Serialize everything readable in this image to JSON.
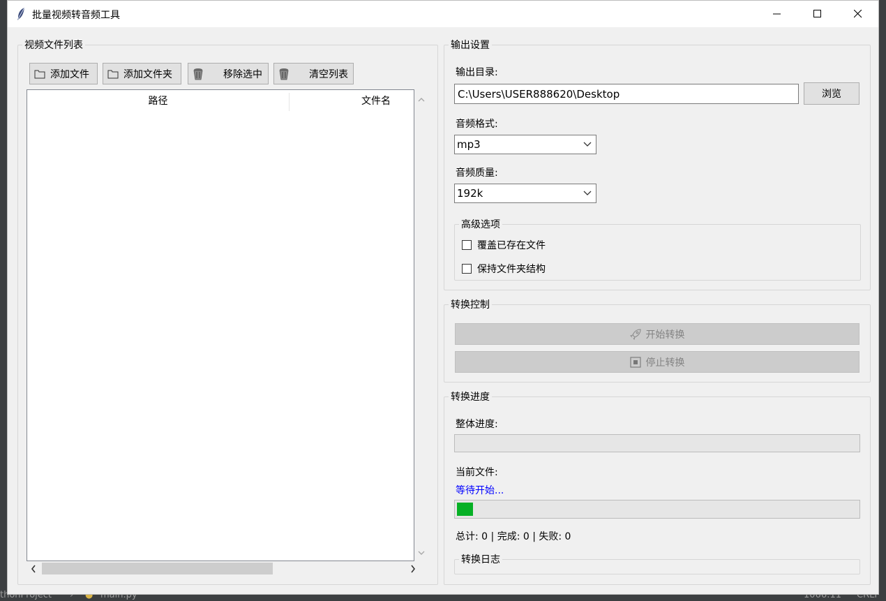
{
  "window": {
    "title": "批量视频转音频工具"
  },
  "file_list": {
    "title": "视频文件列表",
    "buttons": {
      "add_file": "添加文件",
      "add_folder": "添加文件夹",
      "remove_selected": "移除选中",
      "clear_list": "清空列表"
    },
    "columns": [
      "路径",
      "文件名"
    ],
    "rows": []
  },
  "output": {
    "title": "输出设置",
    "dir_label": "输出目录:",
    "dir_value": "C:\\Users\\USER888620\\Desktop",
    "browse": "浏览",
    "format_label": "音频格式:",
    "format_value": "mp3",
    "quality_label": "音频质量:",
    "quality_value": "192k",
    "advanced": {
      "title": "高级选项",
      "overwrite": "覆盖已存在文件",
      "keep_structure": "保持文件夹结构"
    }
  },
  "control": {
    "title": "转换控制",
    "start": "开始转换",
    "stop": "停止转换"
  },
  "progress": {
    "title": "转换进度",
    "overall_label": "整体进度:",
    "overall_value": 0,
    "current_label": "当前文件:",
    "current_status": "等待开始...",
    "current_value": 0.04,
    "stats": "总计: 0 | 完成: 0 | 失败: 0",
    "log_title": "转换日志"
  },
  "background": {
    "project": "thonProject",
    "file": "main.py",
    "position": "1066:11",
    "line_ending": "CRLF"
  },
  "colors": {
    "progress_green": "#06b025",
    "status_blue": "#0000ff"
  }
}
